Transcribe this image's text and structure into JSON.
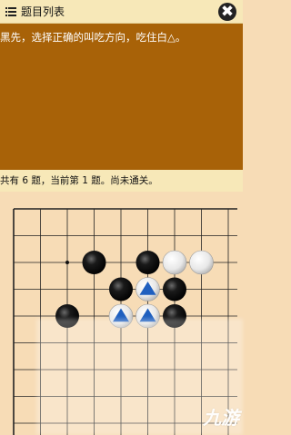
{
  "top_bar": {
    "menu_label": "题目列表",
    "close_symbol": "✖"
  },
  "problem": {
    "text": "黑先，选择正确的叫吃方向，吃住白△。"
  },
  "status": {
    "text": "共有 6 题，当前第 1 题。尚未通关。"
  },
  "colors": {
    "board_bg": "#f7dcb6",
    "panel_bg": "#a86208",
    "bar_bg": "#f7e8b8",
    "triangle": "#1f5fbf"
  },
  "board": {
    "columns": 9,
    "rows": 10,
    "star_points": [
      [
        2,
        2
      ]
    ],
    "black_stones": [
      [
        3,
        2
      ],
      [
        5,
        2
      ],
      [
        4,
        3
      ],
      [
        6,
        3
      ],
      [
        2,
        4
      ],
      [
        6,
        4
      ]
    ],
    "white_stones": [
      [
        6,
        2
      ],
      [
        7,
        2
      ],
      [
        5,
        3
      ],
      [
        4,
        4
      ],
      [
        5,
        4
      ]
    ],
    "marked_white_stones": [
      [
        5,
        3
      ],
      [
        4,
        4
      ],
      [
        5,
        4
      ]
    ]
  },
  "watermark": "九游"
}
